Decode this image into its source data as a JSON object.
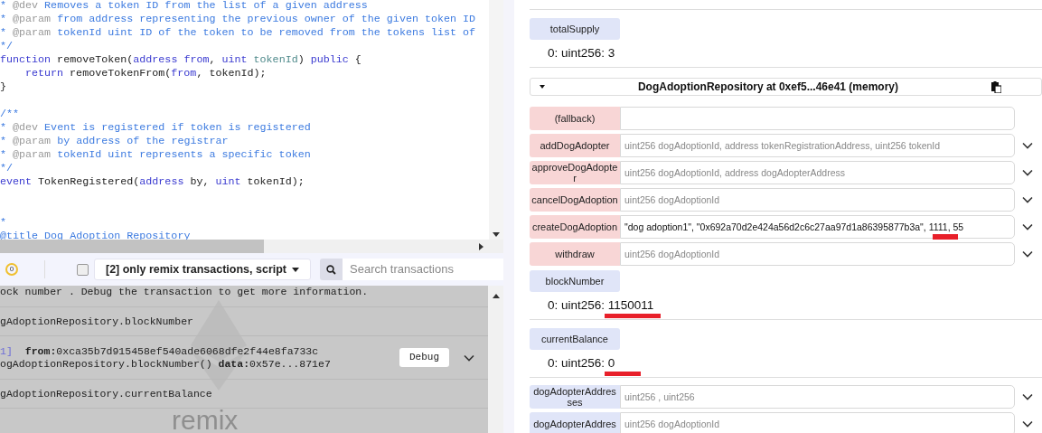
{
  "editor": {
    "lines": [
      {
        "kind": "code",
        "tokens": [
          {
            "kind": "comment",
            "text": "* "
          },
          {
            "kind": "tag",
            "text": "@dev"
          },
          {
            "kind": "comment",
            "text": " Removes a token ID from the list of a given address"
          }
        ]
      },
      {
        "kind": "code",
        "tokens": [
          {
            "kind": "comment",
            "text": "* "
          },
          {
            "kind": "tag",
            "text": "@param"
          },
          {
            "kind": "comment",
            "text": " from address representing the previous owner of the given token ID"
          }
        ]
      },
      {
        "kind": "code",
        "tokens": [
          {
            "kind": "comment",
            "text": "* "
          },
          {
            "kind": "tag",
            "text": "@param"
          },
          {
            "kind": "comment",
            "text": " tokenId uint ID of the token to be removed from the tokens list of"
          }
        ]
      },
      {
        "kind": "code",
        "tokens": [
          {
            "kind": "comment",
            "text": "*/"
          }
        ]
      },
      {
        "kind": "code",
        "tokens": [
          {
            "kind": "keyword",
            "text": "function"
          },
          {
            "kind": "plain",
            "text": " removeToken("
          },
          {
            "kind": "keyword",
            "text": "address from"
          },
          {
            "kind": "plain",
            "text": ", "
          },
          {
            "kind": "keyword",
            "text": "uint"
          },
          {
            "kind": "param",
            "text": " tokenId"
          },
          {
            "kind": "plain",
            "text": ") "
          },
          {
            "kind": "keyword",
            "text": "public"
          },
          {
            "kind": "plain",
            "text": " {"
          }
        ]
      },
      {
        "kind": "indented",
        "tokens": [
          {
            "kind": "keyword",
            "text": "return"
          },
          {
            "kind": "plain",
            "text": " removeTokenFrom("
          },
          {
            "kind": "keyword",
            "text": "from"
          },
          {
            "kind": "plain",
            "text": ", tokenId);"
          }
        ]
      },
      {
        "kind": "code",
        "tokens": [
          {
            "kind": "plain",
            "text": "}"
          }
        ]
      },
      {
        "kind": "blank"
      },
      {
        "kind": "code",
        "tokens": [
          {
            "kind": "comment",
            "text": "/**"
          }
        ]
      },
      {
        "kind": "code",
        "tokens": [
          {
            "kind": "comment",
            "text": "* "
          },
          {
            "kind": "tag",
            "text": "@dev"
          },
          {
            "kind": "comment",
            "text": " Event is registered if token is registered"
          }
        ]
      },
      {
        "kind": "code",
        "tokens": [
          {
            "kind": "comment",
            "text": "* "
          },
          {
            "kind": "tag",
            "text": "@param"
          },
          {
            "kind": "comment",
            "text": " by address of the registrar"
          }
        ]
      },
      {
        "kind": "code",
        "tokens": [
          {
            "kind": "comment",
            "text": "* "
          },
          {
            "kind": "tag",
            "text": "@param"
          },
          {
            "kind": "comment",
            "text": " tokenId uint represents a specific token"
          }
        ]
      },
      {
        "kind": "code",
        "tokens": [
          {
            "kind": "comment",
            "text": "*/"
          }
        ]
      },
      {
        "kind": "code",
        "tokens": [
          {
            "kind": "keyword",
            "text": "event"
          },
          {
            "kind": "plain",
            "text": " TokenRegistered("
          },
          {
            "kind": "keyword",
            "text": "address"
          },
          {
            "kind": "plain",
            "text": " by, "
          },
          {
            "kind": "keyword",
            "text": "uint"
          },
          {
            "kind": "plain",
            "text": " tokenId);"
          }
        ]
      },
      {
        "kind": "blank"
      },
      {
        "kind": "blank"
      },
      {
        "kind": "code",
        "tokens": [
          {
            "kind": "comment",
            "text": "*"
          }
        ]
      },
      {
        "kind": "code",
        "tokens": [
          {
            "kind": "comment",
            "text": "@title Dog Adoption Repository"
          }
        ]
      }
    ]
  },
  "terminal": {
    "pending_count": "0",
    "filter_checked": false,
    "filter": "[2] only remix transactions, script",
    "search_placeholder": "Search transactions",
    "watermark_text": "remix",
    "entries": [
      {
        "kind": "log",
        "lines": [
          [
            {
              "kind": "plain",
              "text": "ock number . Debug the transaction to get more information."
            }
          ]
        ]
      },
      {
        "kind": "call",
        "lines": [
          [
            {
              "kind": "plain",
              "text": "gAdoptionRepository.blockNumber"
            }
          ]
        ]
      },
      {
        "kind": "tx",
        "button": "Debug",
        "lines": [
          [
            {
              "kind": "index",
              "text": "1]"
            },
            {
              "kind": "bold",
              "text": "from:"
            },
            {
              "kind": "plain",
              "text": "0xca35b7d915458ef540ade6068dfe2f44e8fa733c"
            }
          ],
          [
            {
              "kind": "plain",
              "text": "ogAdoptionRepository.blockNumber() "
            },
            {
              "kind": "bold",
              "text": "data:"
            },
            {
              "kind": "plain",
              "text": "0x57e...871e7"
            }
          ]
        ]
      },
      {
        "kind": "call",
        "lines": [
          [
            {
              "kind": "plain",
              "text": "gAdoptionRepository.currentBalance"
            }
          ]
        ]
      }
    ]
  },
  "run_panel": {
    "previous": {
      "label": "totalSupply",
      "output_prefix": "0: uint256:",
      "output_value": "3",
      "marked": false
    },
    "contract": {
      "title": "DogAdoptionRepository at 0xef5...46e41 (memory)",
      "expanded": true
    },
    "functions": [
      {
        "kind": "transact",
        "label": "(fallback)",
        "expandable": false
      },
      {
        "kind": "transact",
        "label": "addDogAdopter",
        "placeholder": "uint256 dogAdoptionId, address tokenRegistrationAddress, uint256 tokenId",
        "expandable": true
      },
      {
        "kind": "transact",
        "label": "approveDogAdopter",
        "placeholder": "uint256 dogAdoptionId, address dogAdopterAddress",
        "expandable": true
      },
      {
        "kind": "transact",
        "label": "cancelDogAdoption",
        "placeholder": "uint256 dogAdoptionId",
        "expandable": true
      },
      {
        "kind": "transact",
        "label": "createDogAdoption",
        "value": "\"dog adoption1\", \"0x692a70d2e424a56d2c6c27aa97d1a86395877b3a\", 1111, 55",
        "expandable": true,
        "marked": true
      },
      {
        "kind": "transact",
        "label": "withdraw",
        "placeholder": "uint256 dogAdoptionId",
        "expandable": true
      },
      {
        "kind": "call",
        "label": "blockNumber",
        "output_prefix": "0: uint256:",
        "output_value": "1150011",
        "marked": true
      },
      {
        "kind": "call",
        "label": "currentBalance",
        "output_prefix": "0: uint256:",
        "output_value": "0",
        "marked": true
      },
      {
        "kind": "call",
        "label": "dogAdopterAddresses",
        "placeholder": "uint256 , uint256",
        "expandable": true
      },
      {
        "kind": "call",
        "label": "dogAdopterAddres",
        "placeholder": "uint256 dogAdoptionId",
        "expandable": true
      }
    ]
  }
}
